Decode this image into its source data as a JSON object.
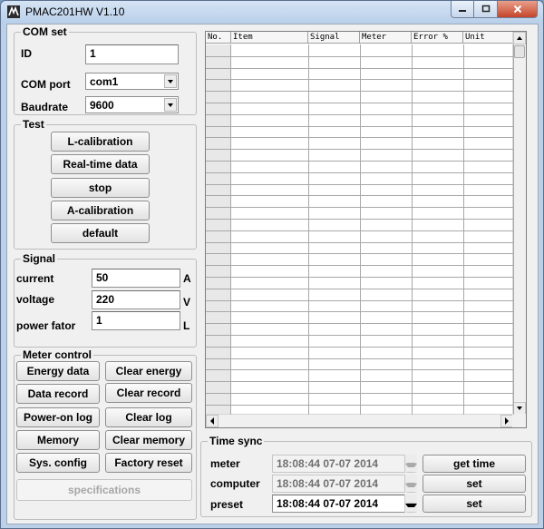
{
  "window": {
    "title": "PMAC201HW V1.10"
  },
  "com_set": {
    "legend": "COM set",
    "id_label": "ID",
    "id_value": "1",
    "port_label": "COM port",
    "port_value": "com1",
    "baud_label": "Baudrate",
    "baud_value": "9600"
  },
  "test": {
    "legend": "Test",
    "buttons": [
      "L-calibration",
      "Real-time data",
      "stop",
      "A-calibration",
      "default"
    ]
  },
  "signal": {
    "legend": "Signal",
    "current_label": "current",
    "current_value": "50",
    "current_unit": "A",
    "voltage_label": "voltage",
    "voltage_value": "220",
    "voltage_unit": "V",
    "pf_label": "power fator",
    "pf_value": "1",
    "pf_unit": "L"
  },
  "meter_control": {
    "legend": "Meter control",
    "left_buttons": [
      "Energy data",
      "Data record",
      "Power-on log",
      "Memory",
      "Sys. config"
    ],
    "right_buttons": [
      "Clear energy",
      "Clear record",
      "Clear log",
      "Clear memory",
      "Factory reset"
    ],
    "specifications": "specifications"
  },
  "grid": {
    "columns": [
      "No.",
      "Item",
      "Signal",
      "Meter",
      "Error %",
      "Unit"
    ]
  },
  "time_sync": {
    "legend": "Time sync",
    "meter_label": "meter",
    "meter_value": "18:08:44  07-07  2014",
    "computer_label": "computer",
    "computer_value": "18:08:44  07-07  2014",
    "preset_label": "preset",
    "preset_value": "18:08:44  07-07  2014",
    "get_time": "get time",
    "set_computer": "set",
    "set_preset": "set"
  }
}
